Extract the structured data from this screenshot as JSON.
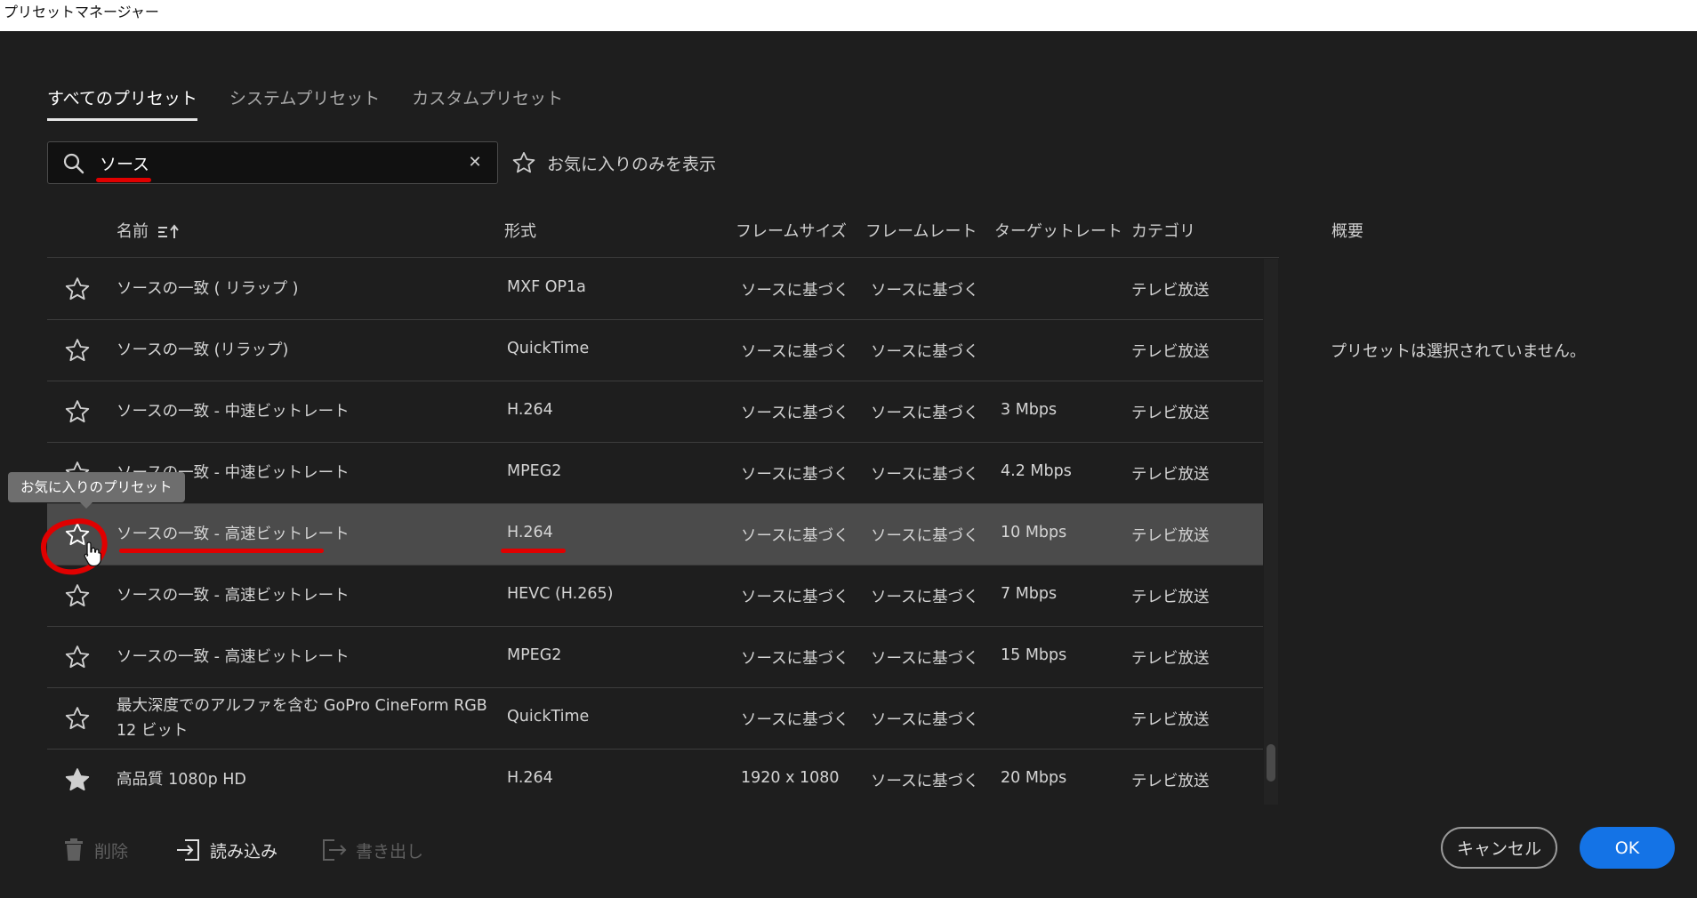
{
  "window": {
    "title": "プリセットマネージャー"
  },
  "tabs": [
    {
      "label": "すべてのプリセット",
      "active": true
    },
    {
      "label": "システムプリセット",
      "active": false
    },
    {
      "label": "カスタムプリセット",
      "active": false
    }
  ],
  "search": {
    "value": "ソース",
    "placeholder": ""
  },
  "favorites_filter": {
    "label": "お気に入りのみを表示"
  },
  "columns": {
    "name": "名前",
    "format": "形式",
    "frame_size": "フレームサイズ",
    "frame_rate": "フレームレート",
    "target_rate": "ターゲットレート",
    "category": "カテゴリ"
  },
  "overview": {
    "title": "概要",
    "empty_message": "プリセットは選択されていません。"
  },
  "tooltip": {
    "text": "お気に入りのプリセット"
  },
  "rows": [
    {
      "name": "ソースの一致 ( リラップ )",
      "format": "MXF OP1a",
      "frame_size": "ソースに基づく",
      "frame_rate": "ソースに基づく",
      "target_rate": "",
      "category": "テレビ放送",
      "favorite": false
    },
    {
      "name": "ソースの一致 (リラップ)",
      "format": "QuickTime",
      "frame_size": "ソースに基づく",
      "frame_rate": "ソースに基づく",
      "target_rate": "",
      "category": "テレビ放送",
      "favorite": false
    },
    {
      "name": "ソースの一致 - 中速ビットレート",
      "format": "H.264",
      "frame_size": "ソースに基づく",
      "frame_rate": "ソースに基づく",
      "target_rate": "3 Mbps",
      "category": "テレビ放送",
      "favorite": false
    },
    {
      "name": "ソースの一致 - 中速ビットレート",
      "format": "MPEG2",
      "frame_size": "ソースに基づく",
      "frame_rate": "ソースに基づく",
      "target_rate": "4.2 Mbps",
      "category": "テレビ放送",
      "favorite": false
    },
    {
      "name": "ソースの一致 - 高速ビットレート",
      "format": "H.264",
      "frame_size": "ソースに基づく",
      "frame_rate": "ソースに基づく",
      "target_rate": "10 Mbps",
      "category": "テレビ放送",
      "favorite": false,
      "selected": true
    },
    {
      "name": "ソースの一致 - 高速ビットレート",
      "format": "HEVC (H.265)",
      "frame_size": "ソースに基づく",
      "frame_rate": "ソースに基づく",
      "target_rate": "7 Mbps",
      "category": "テレビ放送",
      "favorite": false
    },
    {
      "name": "ソースの一致 - 高速ビットレート",
      "format": "MPEG2",
      "frame_size": "ソースに基づく",
      "frame_rate": "ソースに基づく",
      "target_rate": "15 Mbps",
      "category": "テレビ放送",
      "favorite": false
    },
    {
      "name": "最大深度でのアルファを含む GoPro CineForm RGB 12 ビット",
      "format": "QuickTime",
      "frame_size": "ソースに基づく",
      "frame_rate": "ソースに基づく",
      "target_rate": "",
      "category": "テレビ放送",
      "favorite": false
    },
    {
      "name": "高品質 1080p HD",
      "format": "H.264",
      "frame_size": "1920 x 1080",
      "frame_rate": "ソースに基づく",
      "target_rate": "20 Mbps",
      "category": "テレビ放送",
      "favorite": true
    }
  ],
  "footer": {
    "delete_label": "削除",
    "import_label": "読み込み",
    "export_label": "書き出し",
    "cancel_label": "キャンセル",
    "ok_label": "OK"
  },
  "colors": {
    "accent": "#1473e6",
    "annotation": "#e00000",
    "background": "#1e1e1e",
    "selected_row": "#4b4b4b"
  }
}
